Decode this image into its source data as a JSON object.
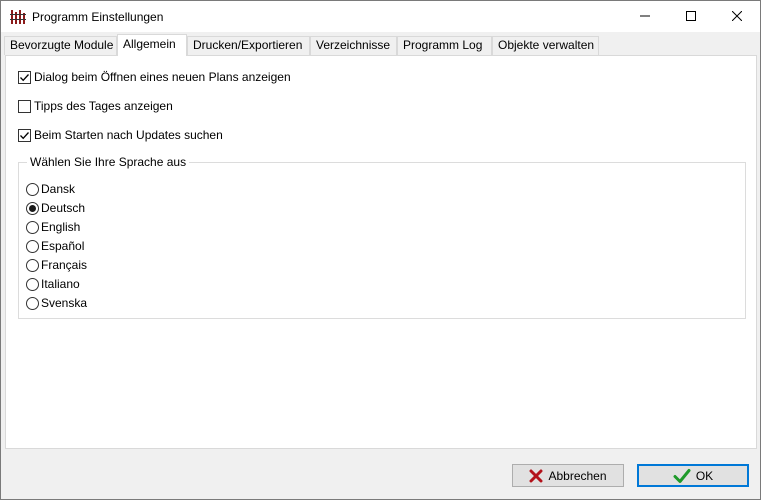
{
  "window": {
    "title": "Programm Einstellungen",
    "icon": "app-icon",
    "controls": {
      "minimize": "minimize-icon",
      "maximize": "maximize-icon",
      "close": "close-icon"
    }
  },
  "tabs": [
    {
      "label": "Bevorzugte Module",
      "active": false
    },
    {
      "label": "Allgemein",
      "active": true
    },
    {
      "label": "Drucken/Exportieren",
      "active": false
    },
    {
      "label": "Verzeichnisse",
      "active": false
    },
    {
      "label": "Programm Log",
      "active": false
    },
    {
      "label": "Objekte verwalten",
      "active": false
    }
  ],
  "options": [
    {
      "label": "Dialog beim Öffnen eines neuen Plans anzeigen",
      "checked": true
    },
    {
      "label": "Tipps des Tages anzeigen",
      "checked": false
    },
    {
      "label": "Beim Starten nach Updates suchen",
      "checked": true
    }
  ],
  "language_group": {
    "title": "Wählen Sie Ihre Sprache aus",
    "languages": [
      {
        "label": "Dansk",
        "selected": false
      },
      {
        "label": "Deutsch",
        "selected": true
      },
      {
        "label": "English",
        "selected": false
      },
      {
        "label": "Español",
        "selected": false
      },
      {
        "label": "Français",
        "selected": false
      },
      {
        "label": "Italiano",
        "selected": false
      },
      {
        "label": "Svenska",
        "selected": false
      }
    ]
  },
  "buttons": {
    "cancel_label": "Abbrechen",
    "ok_label": "OK"
  },
  "colors": {
    "accent": "#0078d7",
    "cancel_icon": "#b3121b",
    "ok_icon": "#1e9a2a",
    "app_icon": "#8b1a1a"
  }
}
